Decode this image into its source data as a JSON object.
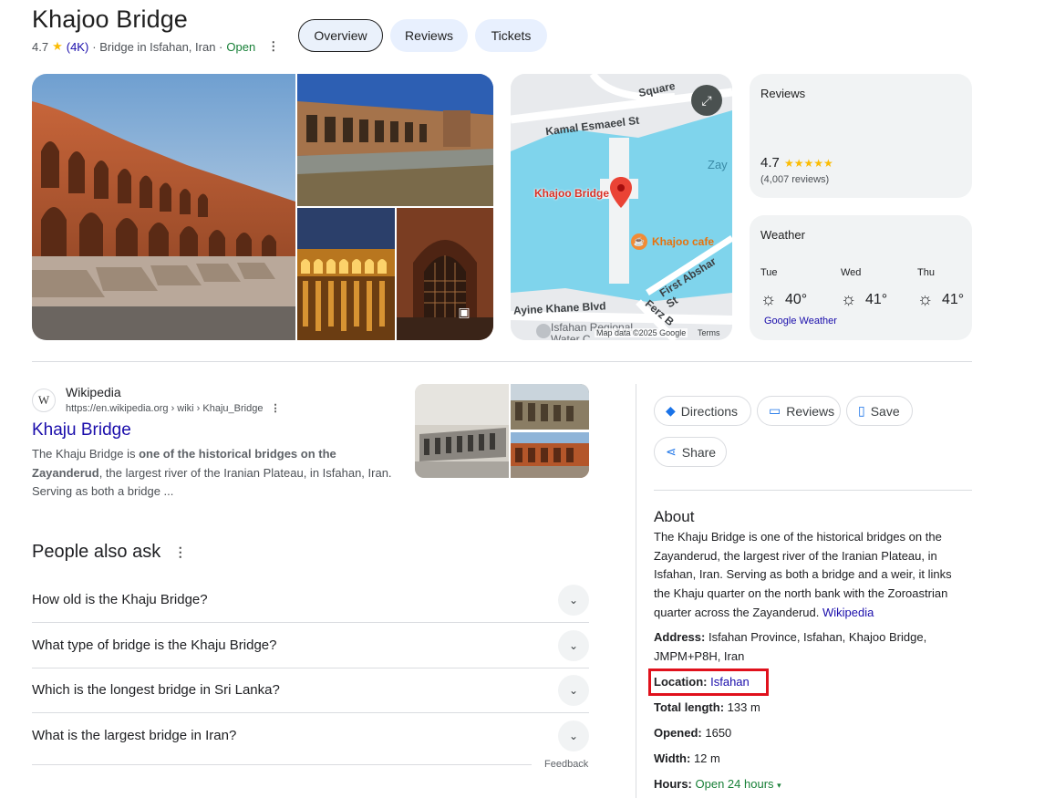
{
  "header": {
    "title": "Khajoo Bridge",
    "rating": "4.7",
    "review_count": "(4K)",
    "category": "· Bridge in Isfahan, Iran ·",
    "status": "Open"
  },
  "tabs": [
    {
      "label": "Overview",
      "active": true
    },
    {
      "label": "Reviews",
      "active": false
    },
    {
      "label": "Tickets",
      "active": false
    }
  ],
  "map": {
    "street_1": "Kamal Esmaeel St",
    "street_2": "Square",
    "street_3": "First Abshar St",
    "street_4": "Ayine Khane Blvd",
    "street_5": "Ferz B",
    "region": "Isfahan Regional",
    "region_2": "Water C",
    "water": "Zay",
    "pin_label": "Khajoo Bridge",
    "cafe_label": "Khajoo cafe",
    "credit": "Map data ©2025 Google",
    "terms": "Terms"
  },
  "reviews_card": {
    "title": "Reviews",
    "rating": "4.7",
    "stars": "★★★★★",
    "count": "(4,007 reviews)"
  },
  "weather_card": {
    "title": "Weather",
    "days": [
      {
        "day": "Tue",
        "temp": "40°"
      },
      {
        "day": "Wed",
        "temp": "41°"
      },
      {
        "day": "Thu",
        "temp": "41°"
      }
    ],
    "source": "Google Weather"
  },
  "wiki": {
    "logo": "W",
    "source": "Wikipedia",
    "url": "https://en.wikipedia.org › wiki › Khaju_Bridge",
    "title": "Khaju Bridge",
    "snippet_1": "The Khaju Bridge is ",
    "snippet_bold": "one of the historical bridges on the Zayanderud",
    "snippet_2": ", the largest river of the Iranian Plateau, in Isfahan, Iran. Serving as both a bridge ..."
  },
  "paa": {
    "title": "People also ask",
    "questions": [
      "How old is the Khaju Bridge?",
      "What type of bridge is the Khaju Bridge?",
      "Which is the longest bridge in Sri Lanka?",
      "What is the largest bridge in Iran?"
    ],
    "feedback": "Feedback"
  },
  "actions": {
    "directions": "Directions",
    "reviews": "Reviews",
    "save": "Save",
    "share": "Share"
  },
  "about": {
    "heading": "About",
    "text": "The Khaju Bridge is one of the historical bridges on the Zayanderud, the largest river of the Iranian Plateau, in Isfahan, Iran. Serving as both a bridge and a weir, it links the Khaju quarter on the north bank with the Zoroastrian quarter across the Zayanderud. ",
    "source_link": "Wikipedia",
    "facts": {
      "address_label": "Address:",
      "address_value": "Isfahan Province, Isfahan, Khajoo Bridge, JMPM+P8H, Iran",
      "location_label": "Location:",
      "location_value": "Isfahan",
      "length_label": "Total length:",
      "length_value": "133 m",
      "opened_label": "Opened:",
      "opened_value": "1650",
      "width_label": "Width:",
      "width_value": "12 m",
      "hours_label": "Hours:",
      "hours_value": "Open 24 hours"
    }
  },
  "colors": {
    "link": "#1a0dab",
    "open": "#188038",
    "star": "#fbbc04",
    "highlight": "#e0111c",
    "water": "#7fd4ec"
  }
}
